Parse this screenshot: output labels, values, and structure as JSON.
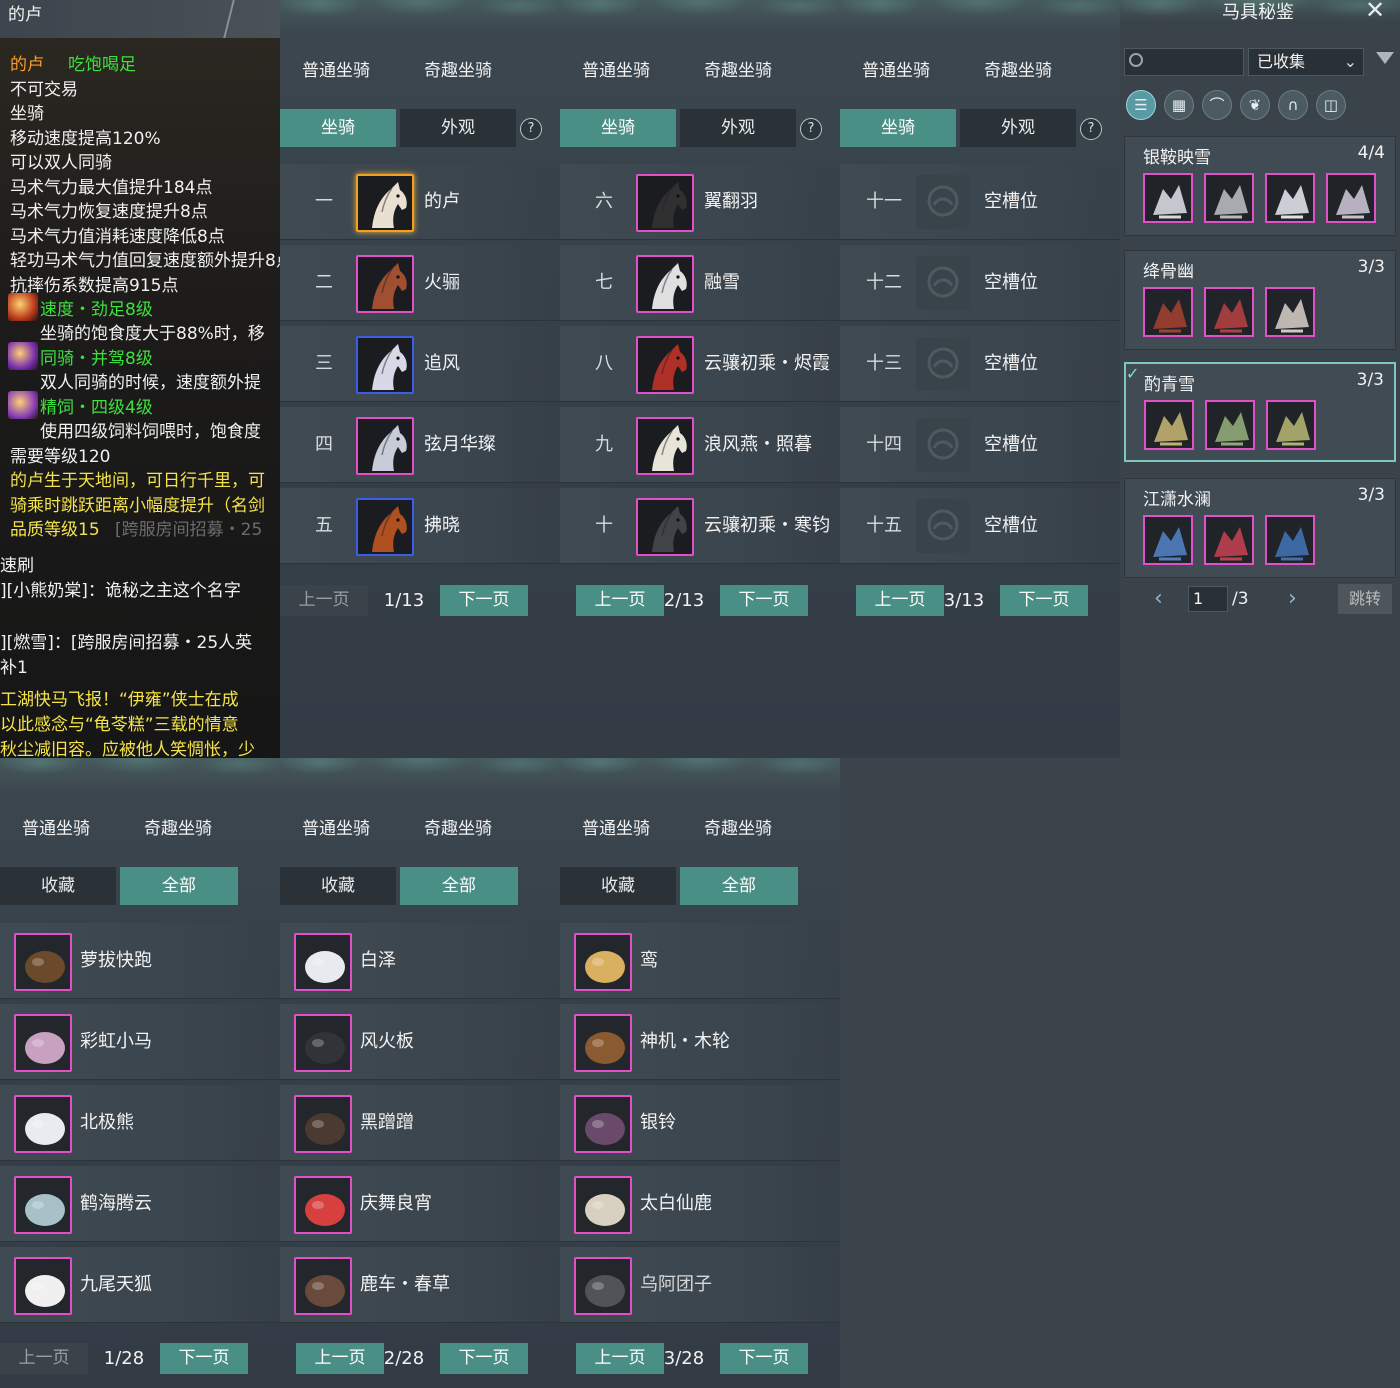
{
  "tooltip": {
    "title": "的卢",
    "lines": [
      {
        "text": "的卢",
        "cls": "c-orange"
      },
      {
        "text": "吃饱喝足",
        "cls": "c-green"
      },
      {
        "text": "不可交易",
        "cls": ""
      },
      {
        "text": "坐骑",
        "cls": ""
      },
      {
        "text": "移动速度提高120%",
        "cls": ""
      },
      {
        "text": "可以双人同骑",
        "cls": ""
      },
      {
        "text": "马术气力最大值提升184点",
        "cls": ""
      },
      {
        "text": "马术气力恢复速度提升8点",
        "cls": ""
      },
      {
        "text": "马术气力值消耗速度降低8点",
        "cls": ""
      },
      {
        "text": "轻功马术气力值回复速度额外提升8点",
        "cls": ""
      },
      {
        "text": "抗摔伤系数提高915点",
        "cls": ""
      },
      {
        "text": "速度・劲足8级",
        "cls": "c-green"
      },
      {
        "text": "坐骑的饱食度大于88%时，移",
        "cls": ""
      },
      {
        "text": "同骑・并驾8级",
        "cls": "c-green"
      },
      {
        "text": "双人同骑的时候，速度额外提",
        "cls": ""
      },
      {
        "text": "精饲・四级4级",
        "cls": "c-green"
      },
      {
        "text": "使用四级饲料饲喂时，饱食度",
        "cls": ""
      },
      {
        "text": "需要等级120",
        "cls": ""
      },
      {
        "text": "的卢生于天地间，可日行千里，可",
        "cls": "c-yellow"
      },
      {
        "text": "骑乘时跳跃距离小幅度提升（名剑",
        "cls": "c-yellow"
      },
      {
        "text": "品质等级15",
        "cls": "c-yellow"
      },
      {
        "text": "[跨服房间招募・25",
        "cls": "c-dim"
      },
      {
        "text": "速刷",
        "cls": ""
      },
      {
        "text": "][小熊奶棠]：诡秘之主这个名字",
        "cls": ""
      },
      {
        "text": "][燃雪]：[跨服房间招募・25人英",
        "cls": ""
      },
      {
        "text": "补1",
        "cls": ""
      },
      {
        "text": "工湖快马飞报！“伊雍”侠士在成",
        "cls": "c-yellow"
      },
      {
        "text": "以此感念与“龟苓糕”三载的情意",
        "cls": "c-yellow"
      },
      {
        "text": "秋尘减旧容。应被他人笑惆怅，少",
        "cls": "c-yellow"
      }
    ]
  },
  "tabs": {
    "normal": "普通坐骑",
    "fun": "奇趣坐骑"
  },
  "subtabs": {
    "mount": "坐骑",
    "look": "外观",
    "fav": "收藏",
    "all": "全部",
    "help": "?"
  },
  "pager": {
    "prev": "上一页",
    "next": "下一页"
  },
  "mount_pages": [
    {
      "page": "1/13",
      "rows": [
        {
          "num": "一",
          "name": "的卢",
          "frame": "gold",
          "hue": "#e8e0d0"
        },
        {
          "num": "二",
          "name": "火骊",
          "frame": "pink",
          "hue": "#a05030"
        },
        {
          "num": "三",
          "name": "追风",
          "frame": "blue",
          "hue": "#d8d8e8"
        },
        {
          "num": "四",
          "name": "弦月华璨",
          "frame": "pink",
          "hue": "#c8ccd8"
        },
        {
          "num": "五",
          "name": "拂晓",
          "frame": "blue",
          "hue": "#b05020"
        }
      ]
    },
    {
      "page": "2/13",
      "rows": [
        {
          "num": "六",
          "name": "翼翻羽",
          "frame": "pink",
          "hue": "#303030"
        },
        {
          "num": "七",
          "name": "融雪",
          "frame": "pink",
          "hue": "#e0e0e0"
        },
        {
          "num": "八",
          "name": "云骧初乘・烬霞",
          "frame": "pink",
          "hue": "#b03028"
        },
        {
          "num": "九",
          "name": "浪风燕・照暮",
          "frame": "pink",
          "hue": "#e8e4d8"
        },
        {
          "num": "十",
          "name": "云骧初乘・寒钧",
          "frame": "pink",
          "hue": "#404448"
        }
      ]
    },
    {
      "page": "3/13",
      "rows": [
        {
          "num": "十一",
          "name": "空槽位",
          "frame": "empty"
        },
        {
          "num": "十二",
          "name": "空槽位",
          "frame": "empty"
        },
        {
          "num": "十三",
          "name": "空槽位",
          "frame": "empty"
        },
        {
          "num": "十四",
          "name": "空槽位",
          "frame": "empty"
        },
        {
          "num": "十五",
          "name": "空槽位",
          "frame": "empty"
        }
      ]
    }
  ],
  "fun_pages": [
    {
      "page": "1/28",
      "rows": [
        {
          "name": "萝拔快跑",
          "hue": "#6a4a2a"
        },
        {
          "name": "彩虹小马",
          "hue": "#c8a0c0"
        },
        {
          "name": "北极熊",
          "hue": "#e8ecf0"
        },
        {
          "name": "鹤海腾云",
          "hue": "#a8c0c8"
        },
        {
          "name": "九尾天狐",
          "hue": "#f0f0f0"
        }
      ]
    },
    {
      "page": "2/28",
      "rows": [
        {
          "name": "白泽",
          "hue": "#e8eaf0"
        },
        {
          "name": "风火板",
          "hue": "#303438"
        },
        {
          "name": "黑蹭蹭",
          "hue": "#4a3a30"
        },
        {
          "name": "庆舞良宵",
          "hue": "#d84040"
        },
        {
          "name": "鹿车・春草",
          "hue": "#6a4a3a"
        }
      ]
    },
    {
      "page": "3/28",
      "rows": [
        {
          "name": "鸾",
          "hue": "#d8b060"
        },
        {
          "name": "神机・木轮",
          "hue": "#8a5a30"
        },
        {
          "name": "银铃",
          "hue": "#6a4a6a"
        },
        {
          "name": "太白仙鹿",
          "hue": "#d8d0c0"
        },
        {
          "name": "乌阿团子",
          "hue": "#505458",
          "dim": true
        }
      ]
    }
  ],
  "equip": {
    "title": "马具秘鉴",
    "filter_value": "已收集",
    "page_input": "1",
    "page_total": "/3",
    "jump": "跳转",
    "sets": [
      {
        "name": "银鞍映雪",
        "count": "4/4",
        "slots": [
          "#d8d8e0",
          "#b8b8c0",
          "#e0e0e8",
          "#c8c0d0"
        ]
      },
      {
        "name": "绛骨幽",
        "count": "3/3",
        "slots": [
          "#a04030",
          "#b04040",
          "#d0c8c0"
        ]
      },
      {
        "name": "酌青雪",
        "count": "3/3",
        "slots": [
          "#c0b070",
          "#90a878",
          "#b0b070"
        ],
        "selected": true
      },
      {
        "name": "江潇水澜",
        "count": "3/3",
        "slots": [
          "#5080c0",
          "#c04050",
          "#4070b0"
        ]
      }
    ]
  }
}
